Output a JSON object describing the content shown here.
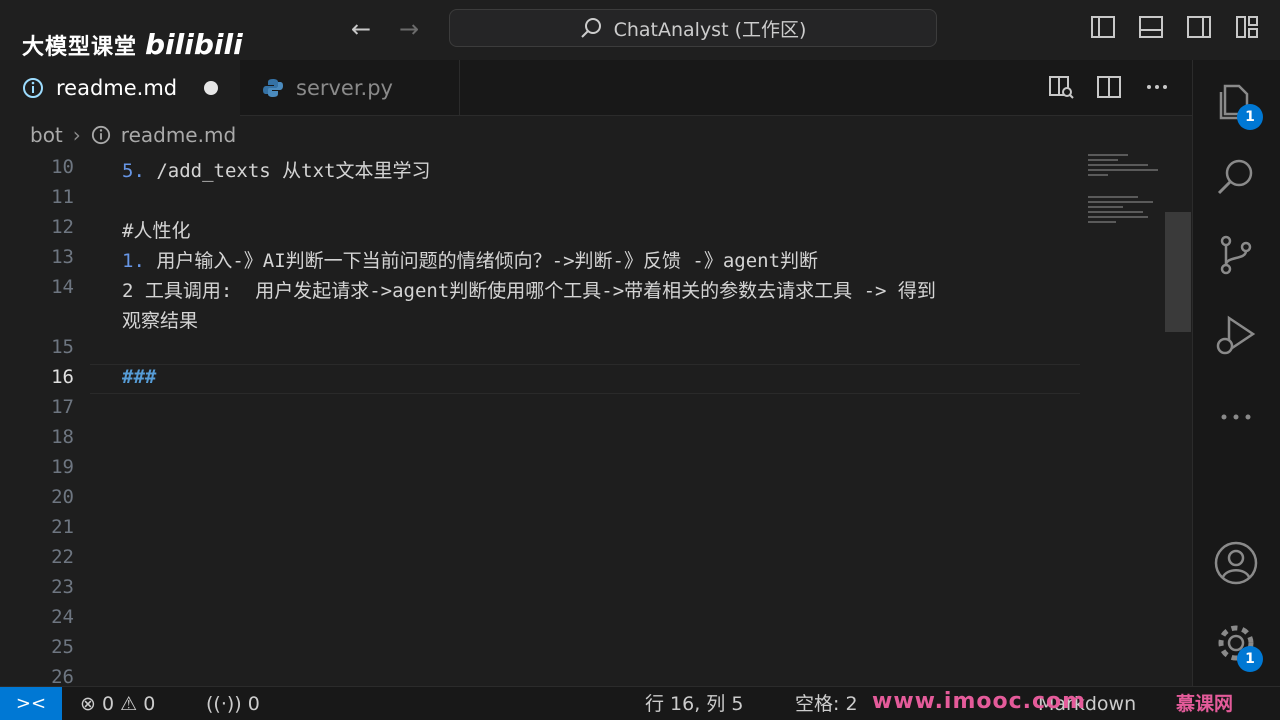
{
  "watermark": {
    "cn": "大模型课堂",
    "logo": "bilibili"
  },
  "titlebar": {
    "back_icon": "←",
    "forward_icon": "→",
    "command_center": "ChatAnalyst (工作区)"
  },
  "tabs": [
    {
      "label": "readme.md",
      "icon": "info-icon",
      "modified": true
    },
    {
      "label": "server.py",
      "icon": "python-icon",
      "modified": false
    }
  ],
  "tab_actions": [
    "open-preview-icon",
    "split-editor-icon",
    "more-actions-icon"
  ],
  "breadcrumb": {
    "folder": "bot",
    "file": "readme.md"
  },
  "editor": {
    "current_line": 16,
    "lines": [
      {
        "n": "10",
        "prefix": "5.",
        "text": " /add_texts 从txt文本里学习"
      },
      {
        "n": "11",
        "prefix": "",
        "text": ""
      },
      {
        "n": "12",
        "prefix": "",
        "text": "#人性化"
      },
      {
        "n": "13",
        "prefix": "1.",
        "text": " 用户输入-》AI判断一下当前问题的情绪倾向？->判断-》反馈 -》agent判断"
      },
      {
        "n": "14",
        "prefix": "",
        "text": "2 工具调用:  用户发起请求->agent判断使用哪个工具->带着相关的参数去请求工具 -> 得到"
      },
      {
        "n": "",
        "prefix": "",
        "text": "观察结果"
      },
      {
        "n": "15",
        "prefix": "",
        "text": ""
      },
      {
        "n": "16",
        "prefix": "",
        "text": "###"
      },
      {
        "n": "17",
        "prefix": "",
        "text": ""
      },
      {
        "n": "18",
        "prefix": "",
        "text": ""
      },
      {
        "n": "19",
        "prefix": "",
        "text": ""
      },
      {
        "n": "20",
        "prefix": "",
        "text": ""
      },
      {
        "n": "21",
        "prefix": "",
        "text": ""
      },
      {
        "n": "22",
        "prefix": "",
        "text": ""
      },
      {
        "n": "23",
        "prefix": "",
        "text": ""
      },
      {
        "n": "24",
        "prefix": "",
        "text": ""
      },
      {
        "n": "25",
        "prefix": "",
        "text": ""
      },
      {
        "n": "26",
        "prefix": "",
        "text": ""
      }
    ]
  },
  "activitybar": {
    "explorer_badge": "1",
    "settings_badge": "1"
  },
  "statusbar": {
    "errors": "0",
    "warnings": "0",
    "ports": "0",
    "position": "行 16, 列 5",
    "spaces": "空格: 2",
    "language": "Markdown",
    "imooc": "www.imooc.com",
    "imooc_cn": "慕课网"
  },
  "colors": {
    "accent": "#0078d4",
    "bg": "#1e1e1e",
    "heading": "#569cd6"
  }
}
